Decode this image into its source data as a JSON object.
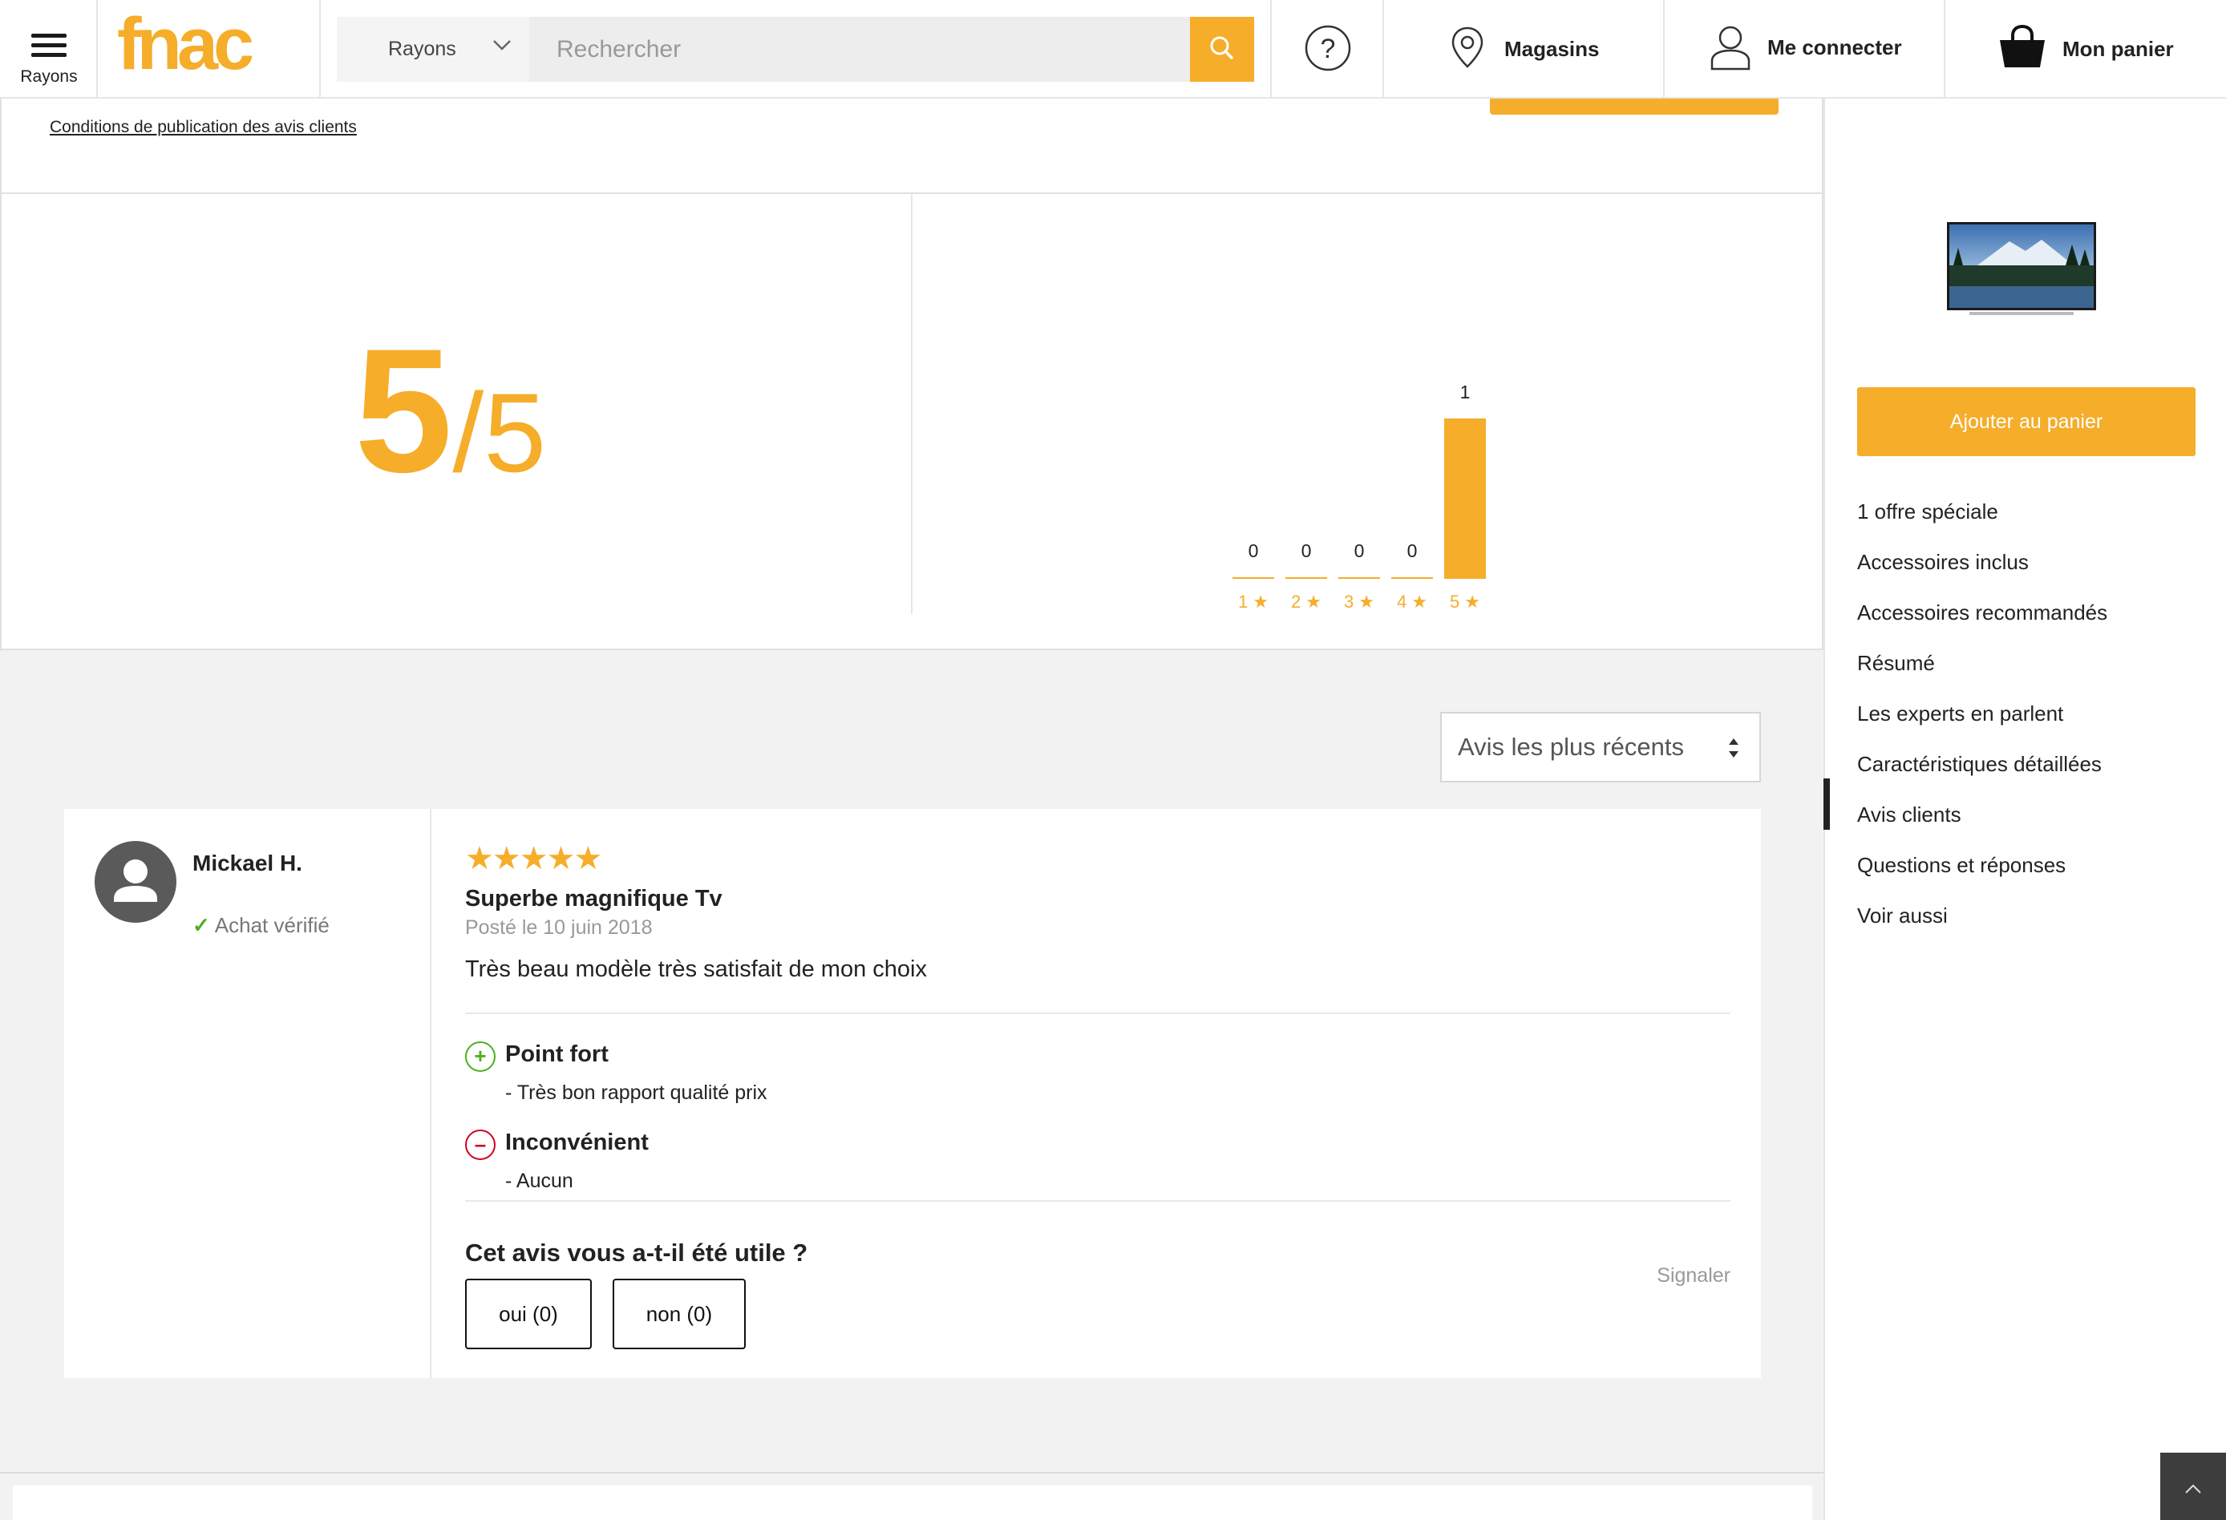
{
  "header": {
    "rayons_label": "Rayons",
    "logo_text": "fnac",
    "search_category": "Rayons",
    "search_placeholder": "Rechercher",
    "stores_label": "Magasins",
    "login_label": "Me connecter",
    "cart_label": "Mon panier"
  },
  "reviews_header": {
    "conditions_link": "Conditions de publication des avis clients"
  },
  "rating": {
    "score": "5",
    "out_of": "/5"
  },
  "chart_data": {
    "type": "bar",
    "categories": [
      "1",
      "2",
      "3",
      "4",
      "5"
    ],
    "values": [
      0,
      0,
      0,
      0,
      1
    ]
  },
  "histogram_labels": [
    "1 ★",
    "2 ★",
    "3 ★",
    "4 ★",
    "5 ★"
  ],
  "sort": {
    "selected": "Avis les plus récents"
  },
  "review": {
    "author": "Mickael H.",
    "verified": "Achat vérifié",
    "stars": "★★★★★",
    "title": "Superbe magnifique Tv",
    "date": "Posté le 10 juin 2018",
    "text": "Très beau modèle très satisfait de mon choix",
    "pro_title": "Point fort",
    "pro_text": "- Très bon rapport qualité prix",
    "con_title": "Inconvénient",
    "con_text": "- Aucun",
    "useful_question": "Cet avis vous a-t-il été utile ?",
    "yes_label": "oui (0)",
    "no_label": "non (0)",
    "report_label": "Signaler"
  },
  "sidebar": {
    "add_to_cart": "Ajouter au panier",
    "nav": [
      "1 offre spéciale",
      "Accessoires inclus",
      "Accessoires recommandés",
      "Résumé",
      "Les experts en parlent",
      "Caractéristiques détaillées",
      "Avis clients",
      "Questions et réponses",
      "Voir aussi"
    ],
    "active_index": 6
  },
  "colors": {
    "accent": "#f5ad2a",
    "pro": "#4caf20",
    "con": "#d0021b"
  }
}
